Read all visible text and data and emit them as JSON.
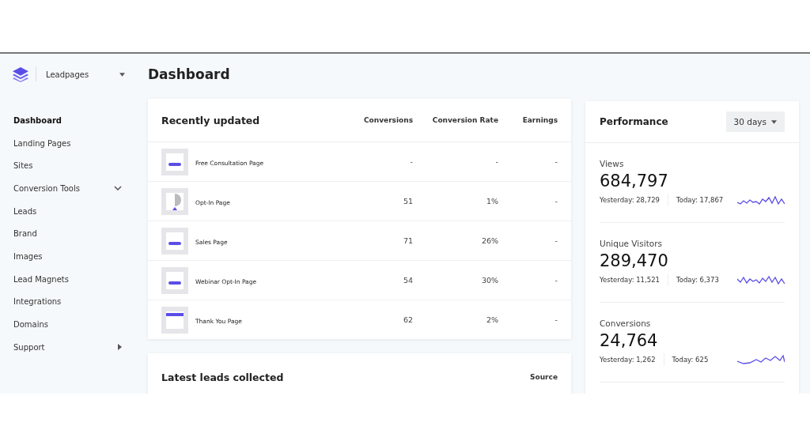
{
  "workspace": {
    "name": "Leadpages"
  },
  "page_title": "Dashboard",
  "sidebar": {
    "items": [
      {
        "label": "Dashboard",
        "selected": true,
        "kind": "plain"
      },
      {
        "label": "Landing Pages",
        "selected": false,
        "kind": "plain"
      },
      {
        "label": "Sites",
        "selected": false,
        "kind": "plain"
      },
      {
        "label": "Conversion Tools",
        "selected": false,
        "kind": "dropdown"
      },
      {
        "label": "Leads",
        "selected": false,
        "kind": "plain"
      },
      {
        "label": "Brand",
        "selected": false,
        "kind": "plain"
      },
      {
        "label": "Images",
        "selected": false,
        "kind": "plain"
      },
      {
        "label": "Lead Magnets",
        "selected": false,
        "kind": "plain"
      },
      {
        "label": "Integrations",
        "selected": false,
        "kind": "plain"
      },
      {
        "label": "Domains",
        "selected": false,
        "kind": "plain"
      },
      {
        "label": "Support",
        "selected": false,
        "kind": "flyout"
      }
    ]
  },
  "recent": {
    "title": "Recently updated",
    "columns": [
      "Conversions",
      "Conversion Rate",
      "Earnings"
    ],
    "rows": [
      {
        "kind": "bar",
        "name": "Free Consultation Page",
        "conversions": "-",
        "rate": "-",
        "earnings": "-"
      },
      {
        "kind": "pie",
        "name": "Opt-In Page",
        "conversions": "51",
        "rate": "1%",
        "earnings": "-"
      },
      {
        "kind": "bar",
        "name": "Sales Page",
        "conversions": "71",
        "rate": "26%",
        "earnings": "-"
      },
      {
        "kind": "bar",
        "name": "Webinar Opt-In Page",
        "conversions": "54",
        "rate": "30%",
        "earnings": "-"
      },
      {
        "kind": "header",
        "name": "Thank You Page",
        "conversions": "62",
        "rate": "2%",
        "earnings": "-"
      }
    ]
  },
  "leads": {
    "title": "Latest leads collected",
    "column": "Source"
  },
  "performance": {
    "title": "Performance",
    "range": "30 days",
    "metrics": [
      {
        "label": "Views",
        "value": "684,797",
        "yesterday": "Yesterday: 28,729",
        "today": "Today: 17,867"
      },
      {
        "label": "Unique Visitors",
        "value": "289,470",
        "yesterday": "Yesterday: 11,521",
        "today": "Today: 6,373"
      },
      {
        "label": "Conversions",
        "value": "24,764",
        "yesterday": "Yesterday: 1,262",
        "today": "Today: 625"
      }
    ]
  }
}
